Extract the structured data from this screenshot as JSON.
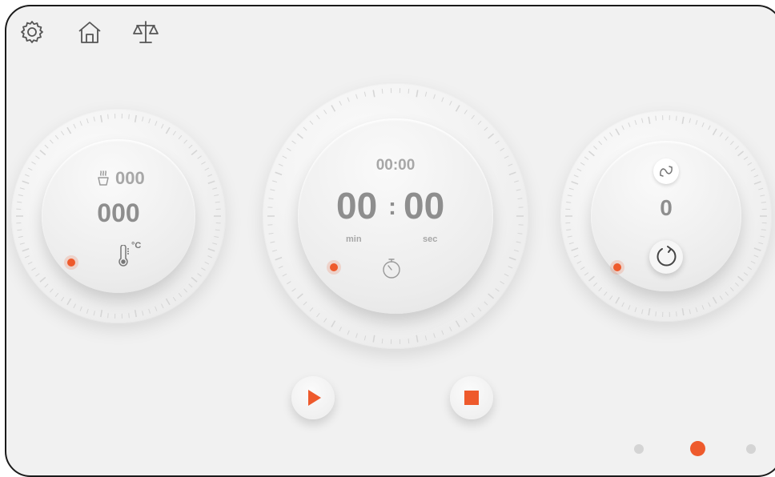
{
  "toolbar": {
    "icons": [
      "gear-icon",
      "home-icon",
      "scale-icon"
    ]
  },
  "heat_dial": {
    "target_label": "000",
    "value": "000",
    "unit": "°C"
  },
  "timer_dial": {
    "set_time": "00:00",
    "minutes": "00",
    "separator": ":",
    "seconds": "00",
    "min_label": "min",
    "sec_label": "sec"
  },
  "speed_dial": {
    "value": "0"
  },
  "controls": {
    "play": "play-icon",
    "stop": "stop-icon"
  },
  "pager": {
    "pages": 3,
    "active": 2
  },
  "colors": {
    "accent": "#ee5a2c",
    "text_value": "#8e8e8e",
    "text_secondary": "#a7a7a7",
    "background": "#f1f1f1"
  }
}
